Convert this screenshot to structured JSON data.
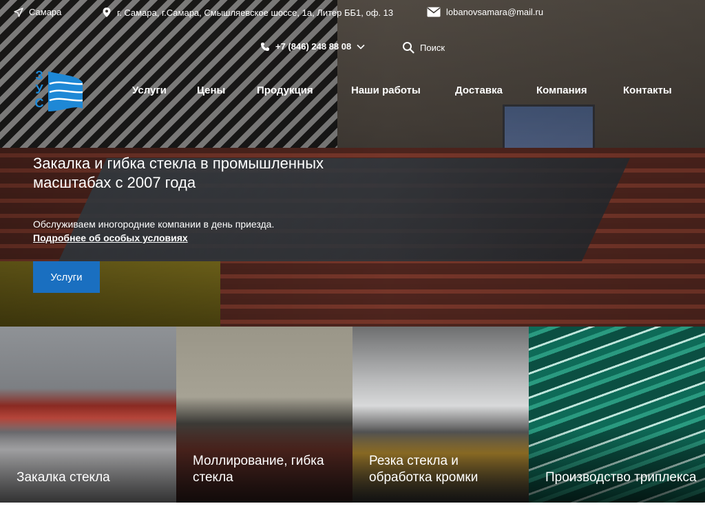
{
  "top_bar": {
    "city": "Самара",
    "address": "г. Самара, г.Самара, Смышляевское шоссе, 1а, Литер ББ1, оф. 13",
    "email": "lobanovsamara@mail.ru"
  },
  "contact": {
    "phone": "+7 (846) 248 88 08",
    "search_label": "Поиск"
  },
  "logo": {
    "letters": [
      "З",
      "У",
      "С"
    ]
  },
  "nav": {
    "items": [
      "Услуги",
      "Цены",
      "Продукция",
      "Наши работы",
      "Доставка",
      "Компания",
      "Контакты"
    ]
  },
  "hero": {
    "headline": "Закалка и гибка стекла в промышленных масштабах с 2007 года",
    "subtext": "Обслуживаем иногородние компании в день приезда.",
    "link": "Подробнее об особых условиях",
    "button": "Услуги"
  },
  "cards": [
    {
      "label": "Закалка стекла"
    },
    {
      "label": "Моллирование, гибка стекла"
    },
    {
      "label": "Резка стекла и обработка кромки"
    },
    {
      "label": "Производство триплекса"
    }
  ],
  "colors": {
    "accent": "#1a6fc0",
    "logo_blue": "#1e88d6"
  }
}
